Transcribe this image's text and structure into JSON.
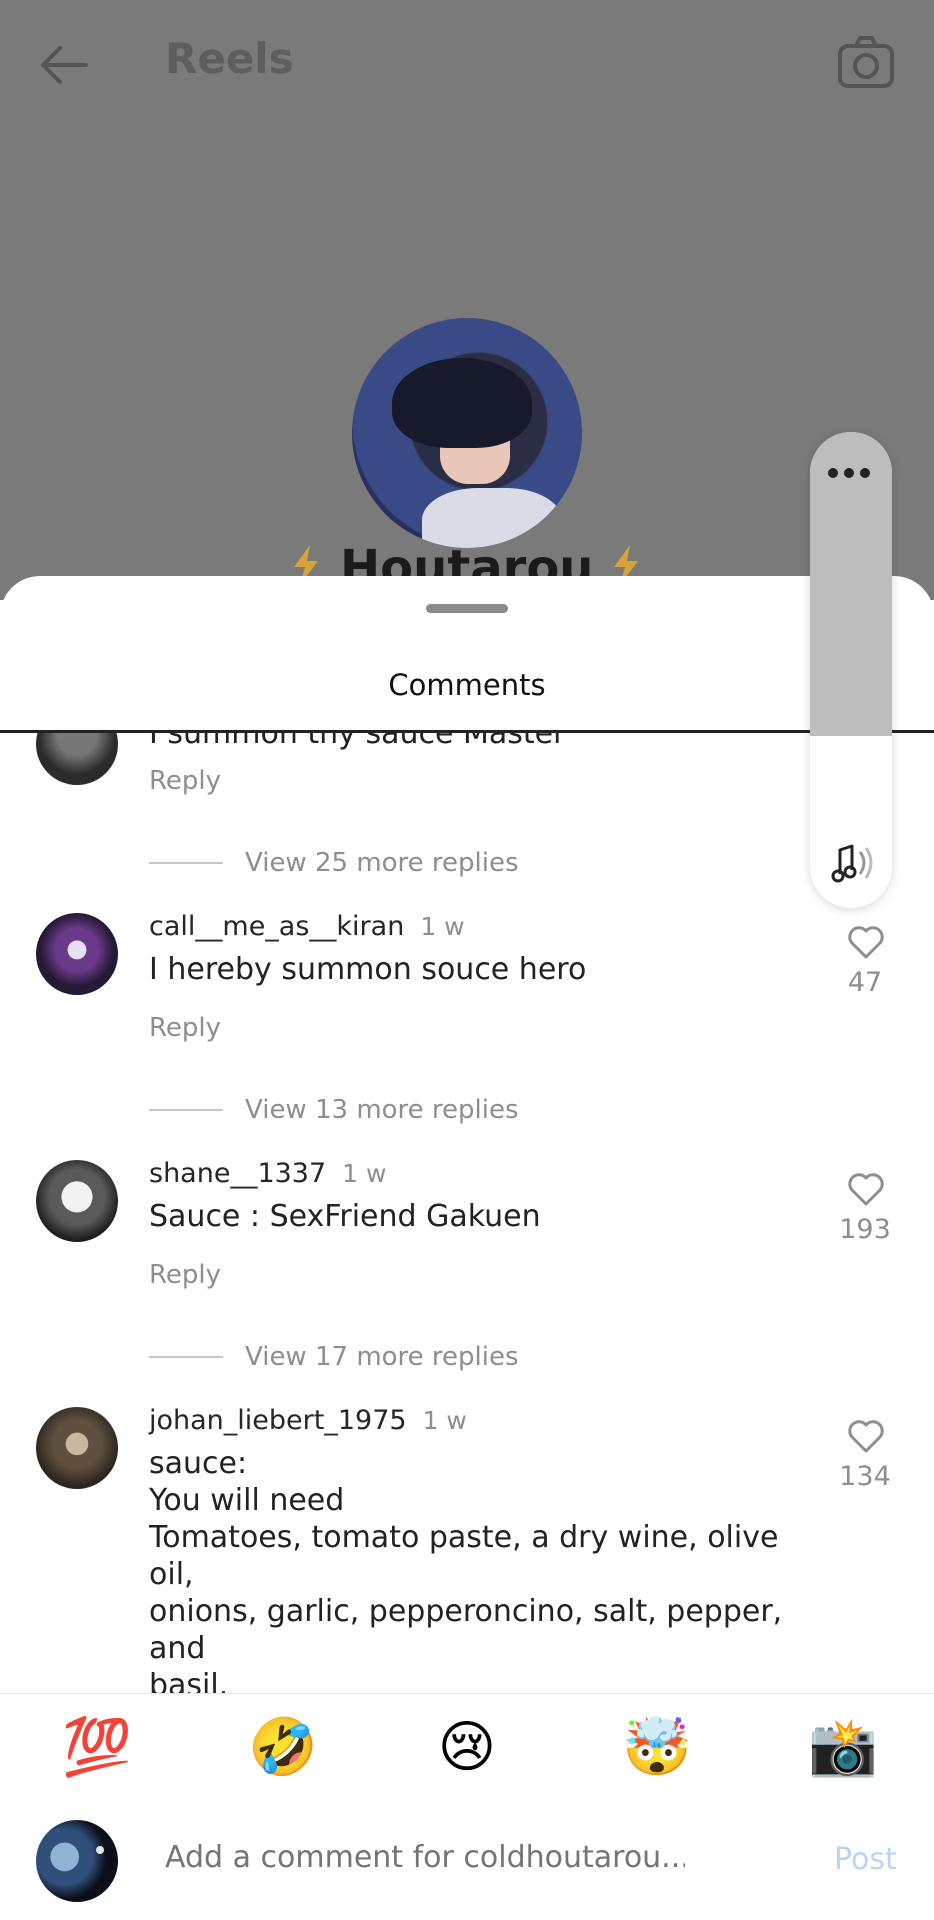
{
  "header": {
    "back_icon": "back-arrow-icon",
    "title": "Reels",
    "camera_icon": "camera-icon"
  },
  "profile": {
    "name_peek": "Houtarou"
  },
  "sheet": {
    "title": "Comments"
  },
  "comments": [
    {
      "text": "I summon thy sauce Master",
      "reply": "Reply",
      "view_more": "View 25 more replies"
    },
    {
      "username": "call__me_as__kiran",
      "time": "1 w",
      "text": "I hereby summon souce hero",
      "reply": "Reply",
      "likes": "47",
      "view_more": "View 13 more replies"
    },
    {
      "username": "shane__1337",
      "time": "1 w",
      "text": "Sauce : SexFriend Gakuen",
      "reply": "Reply",
      "likes": "193",
      "view_more": "View 17 more replies"
    },
    {
      "username": "johan_liebert_1975",
      "time": "1 w",
      "text": "sauce:\nYou will need\nTomatoes, tomato paste, a dry wine, olive oil,\nonions, garlic, pepperoncino, salt, pepper, and\nbasil.\nRecipe",
      "likes": "134"
    }
  ],
  "emojis": [
    "💯",
    "🤣",
    "😢",
    "🤯",
    "📸"
  ],
  "composer": {
    "placeholder": "Add a comment for coldhoutarou...",
    "post_label": "Post"
  },
  "colors": {
    "post_disabled": "#b7d6f6",
    "secondary_text": "#8e8e8e"
  }
}
